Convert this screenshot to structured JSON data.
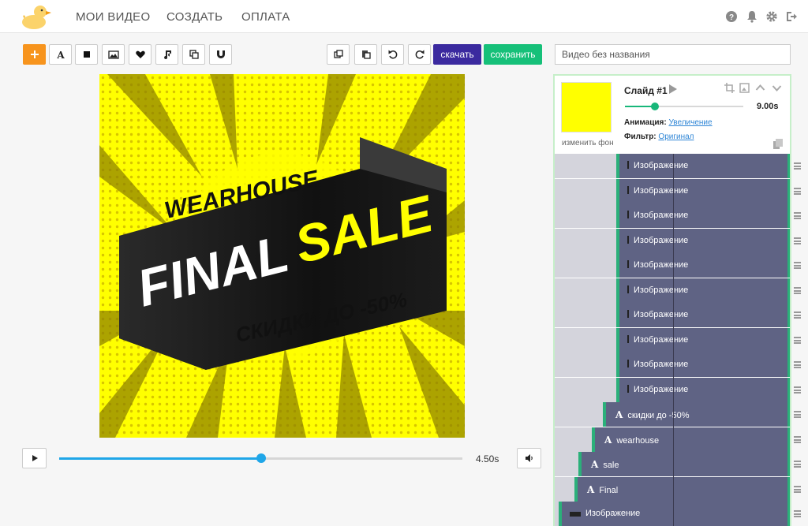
{
  "header": {
    "nav": [
      "МОИ ВИДЕО",
      "СОЗДАТЬ",
      "ОПЛАТА"
    ],
    "icons": [
      "help-icon",
      "bell-icon",
      "gear-icon",
      "logout-icon"
    ]
  },
  "toolbar": {
    "tools": [
      "add-icon",
      "text-icon",
      "shape-icon",
      "image-icon",
      "heart-icon",
      "music-icon",
      "copy-layers-icon",
      "magnet-icon"
    ],
    "actions": [
      "duplicate-icon",
      "paste-icon",
      "undo-icon",
      "redo-icon"
    ],
    "download_label": "скачать",
    "save_label": "сохранить",
    "title_value": "Видео без названия"
  },
  "canvas": {
    "brand": "WEARHOUSE",
    "headline_1": "FINAL",
    "headline_2": "SALE",
    "discount": "СКИДКИ ДО -50%",
    "colors": {
      "background": "#ffff00",
      "ribbon": "#141414",
      "ribbon_fold": "#3a3a3a",
      "headline_accent": "#ffff00",
      "text": "#ffffff"
    }
  },
  "playback": {
    "time_label": "4.50s",
    "progress": 0.5
  },
  "slide": {
    "title": "Слайд #1",
    "duration_label": "9.00s",
    "duration_progress": 0.25,
    "change_bg_label": "изменить фон",
    "animation_label": "Анимация:",
    "animation_value": "Увеличение",
    "filter_label": "Фильтр:",
    "filter_value": "Оригинал"
  },
  "layers": [
    {
      "label": "Изображение",
      "kind": "image"
    },
    {
      "label": "Изображение",
      "kind": "image"
    },
    {
      "label": "Изображение",
      "kind": "image"
    },
    {
      "label": "Изображение",
      "kind": "image"
    },
    {
      "label": "Изображение",
      "kind": "image"
    },
    {
      "label": "Изображение",
      "kind": "image"
    },
    {
      "label": "Изображение",
      "kind": "image"
    },
    {
      "label": "Изображение",
      "kind": "image"
    },
    {
      "label": "Изображение",
      "kind": "image"
    },
    {
      "label": "Изображение",
      "kind": "image"
    },
    {
      "label": "скидки до -50%",
      "kind": "text"
    },
    {
      "label": "wearhouse",
      "kind": "text"
    },
    {
      "label": "sale",
      "kind": "text"
    },
    {
      "label": "Final",
      "kind": "text"
    },
    {
      "label": "Изображение",
      "kind": "image"
    }
  ]
}
